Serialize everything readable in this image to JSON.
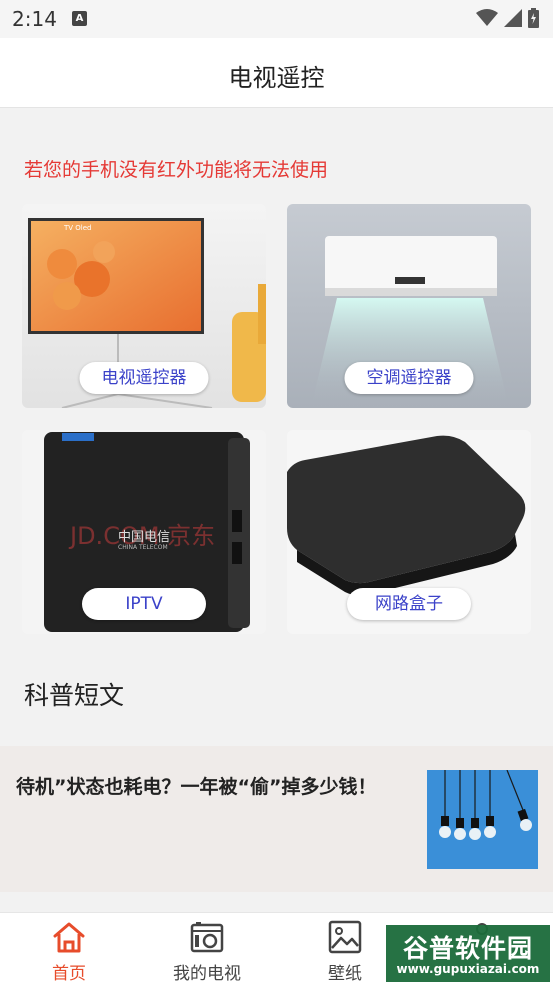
{
  "status_bar": {
    "time": "2:14",
    "notification_icon": "A"
  },
  "header": {
    "title": "电视遥控"
  },
  "warning_text": "若您的手机没有红外功能将无法使用",
  "cards": [
    {
      "label": "电视遥控器",
      "image": "tv-image",
      "tv_brand": "TV Oled"
    },
    {
      "label": "空调遥控器",
      "image": "air-conditioner-image"
    },
    {
      "label": "IPTV",
      "image": "iptv-box-image",
      "box_brand": "中国电信",
      "box_brand_en": "CHINA TELECOM",
      "overlay_watermark": "JD.COM 京东"
    },
    {
      "label": "网路盒子",
      "image": "network-box-image"
    }
  ],
  "section": {
    "title": "科普短文"
  },
  "article": {
    "title": "待机”状态也耗电？一年被“偷”掉多少钱！"
  },
  "bottom_nav": [
    {
      "label": "首页",
      "icon": "home-icon",
      "active": true
    },
    {
      "label": "我的电视",
      "icon": "tv-icon",
      "active": false
    },
    {
      "label": "壁纸",
      "icon": "image-icon",
      "active": false
    }
  ],
  "watermark": {
    "text": "谷普软件园",
    "url": "www.gupuxiazai.com"
  },
  "colors": {
    "warning": "#e53935",
    "accent": "#e74c2b",
    "card_label": "#3b42c9"
  }
}
